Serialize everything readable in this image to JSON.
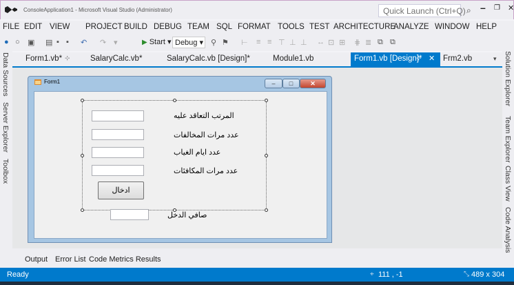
{
  "window": {
    "title": "ConsoleApplication1 - Microsoft Visual Studio (Administrator)",
    "quick_launch_placeholder": "Quick Launch (Ctrl+Q)"
  },
  "menu": [
    "FILE",
    "EDIT",
    "VIEW",
    "PROJECT",
    "BUILD",
    "DEBUG",
    "TEAM",
    "SQL",
    "FORMAT",
    "TOOLS",
    "TEST",
    "ARCHITECTURE",
    "ANALYZE",
    "WINDOW",
    "HELP"
  ],
  "toolbar": {
    "start_label": "Start",
    "configuration": "Debug"
  },
  "left_panels": [
    "Data Sources",
    "Server Explorer",
    "Toolbox"
  ],
  "right_panels": [
    "Solution Explorer",
    "Team Explorer",
    "Class View",
    "Code Analysis"
  ],
  "doc_tabs": [
    "Form1.vb*",
    "SalaryCalc.vb*",
    "SalaryCalc.vb [Design]*",
    "Module1.vb",
    "Form1.vb [Design]*",
    "Frm2.vb"
  ],
  "form": {
    "caption": "Form1",
    "labels": [
      "المرتب التعاقد عليه",
      "عدد مرات المخالفات",
      "عدد ايام الغياب",
      "عدد  مرات المكافئات"
    ],
    "submit_label": "ادخال",
    "net_income_label": "صافي الدخل"
  },
  "bottom_tabs": [
    "Output",
    "Error List",
    "Code Metrics Results"
  ],
  "status": {
    "text": "Ready",
    "position": "111 , -1",
    "size": "489 x 304"
  },
  "colors": {
    "accent": "#007acc",
    "chrome": "#eeeef2"
  }
}
